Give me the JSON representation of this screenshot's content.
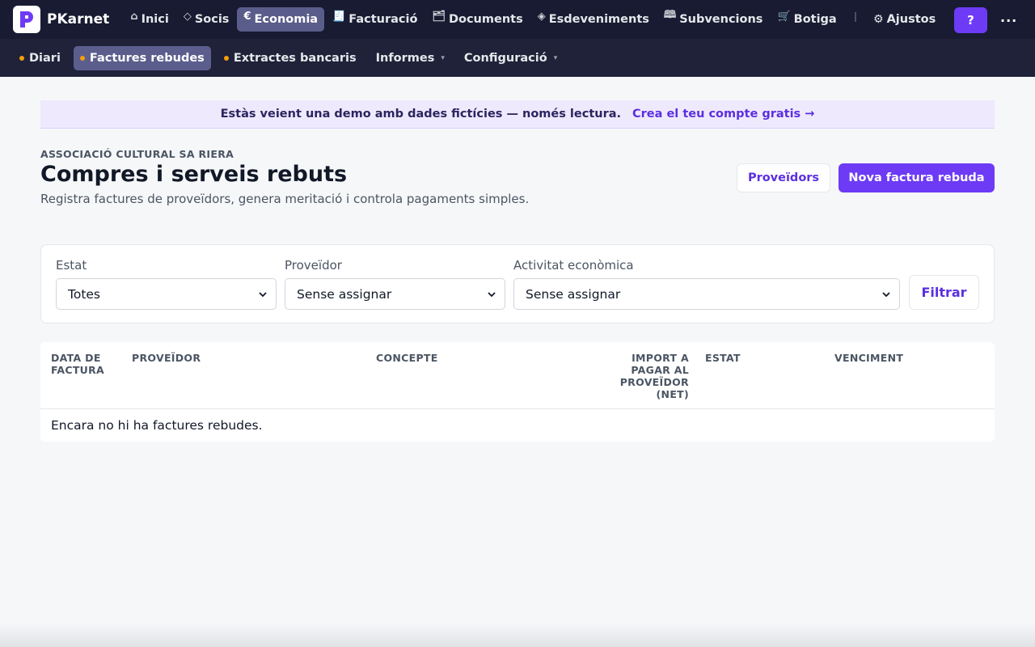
{
  "app": {
    "name": "PKarnet",
    "accent": "#6d3bf5",
    "nav_bg": "#181b31"
  },
  "topnav": {
    "items": [
      {
        "label": "Inici",
        "icon": "home-icon",
        "glyph": "⌂"
      },
      {
        "label": "Socis",
        "icon": "diamond-icon",
        "glyph": "◇"
      },
      {
        "label": "Economia",
        "icon": "euro-icon",
        "glyph": "€",
        "active": true
      },
      {
        "label": "Facturació",
        "icon": "receipt-icon",
        "glyph": "🧾"
      },
      {
        "label": "Documents",
        "icon": "folder-icon",
        "glyph": "🗂"
      },
      {
        "label": "Esdeveniments",
        "icon": "sparkle-diamond-icon",
        "glyph": "◈"
      },
      {
        "label": "Subvencions",
        "icon": "book-icon",
        "glyph": "🕮"
      },
      {
        "label": "Botiga",
        "icon": "cart-icon",
        "glyph": "🛒"
      }
    ],
    "settings_label": "Ajustos",
    "settings_glyph": "⚙",
    "help_label": "?",
    "more_label": "..."
  },
  "subnav": {
    "items": [
      {
        "label": "Diari",
        "dot": true
      },
      {
        "label": "Factures rebudes",
        "dot": true,
        "active": true
      },
      {
        "label": "Extractes bancaris",
        "dot": true
      },
      {
        "label": "Informes",
        "caret": "▾"
      },
      {
        "label": "Configuració",
        "caret": "▾"
      }
    ]
  },
  "banner": {
    "text": "Estàs veient una demo amb dades fictícies — només lectura.",
    "link": "Crea el teu compte gratis →"
  },
  "header": {
    "org": "ASSOCIACIÓ CULTURAL SA RIERA",
    "title": "Compres i serveis rebuts",
    "subtitle": "Registra factures de proveïdors, genera meritació i controla pagaments simples.",
    "suppliers_button": "Proveïdors",
    "new_button": "Nova factura rebuda"
  },
  "filters": {
    "status": {
      "label": "Estat",
      "value": "Totes"
    },
    "supplier": {
      "label": "Proveïdor",
      "value": "Sense assignar"
    },
    "activity": {
      "label": "Activitat econòmica",
      "value": "Sense assignar"
    },
    "submit": "Filtrar"
  },
  "table": {
    "columns": {
      "date": "DATA DE FACTURA",
      "supplier": "PROVEÏDOR",
      "concept": "CONCEPTE",
      "amount": "IMPORT A PAGAR AL PROVEÏDOR (NET)",
      "status": "ESTAT",
      "due": "VENCIMENT"
    },
    "empty_message": "Encara no hi ha factures rebudes."
  }
}
